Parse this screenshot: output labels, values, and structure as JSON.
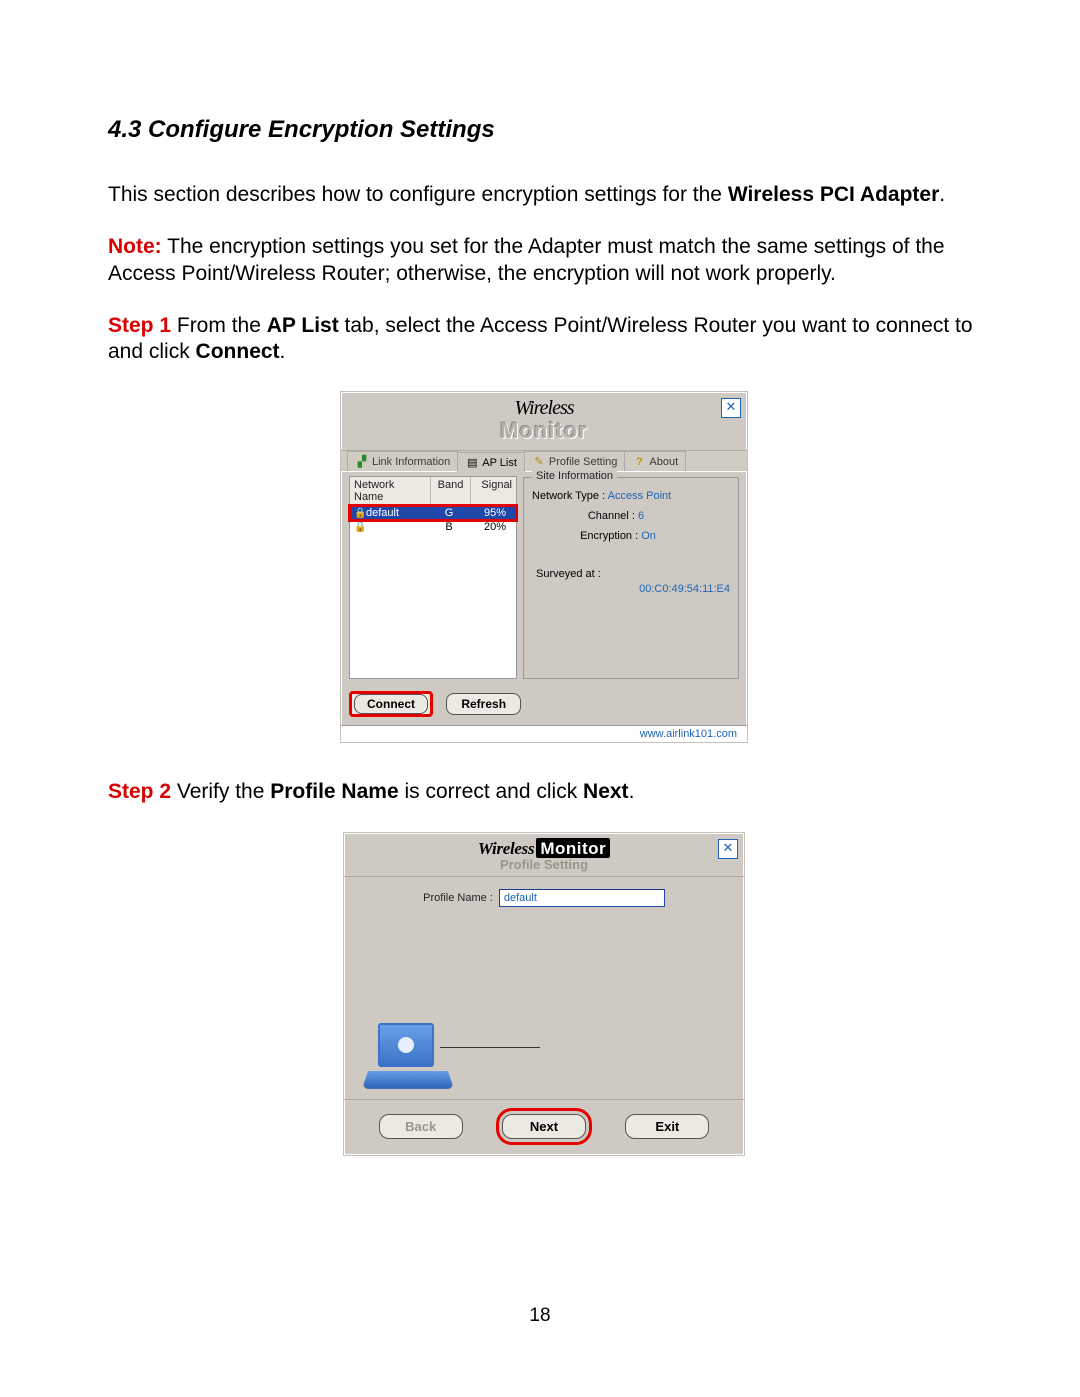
{
  "section": {
    "heading": "4.3 Configure Encryption Settings"
  },
  "para1": {
    "pre": "This section describes how to configure encryption settings for the ",
    "bold": "Wireless PCI Adapter",
    "post": "."
  },
  "para2": {
    "note": "Note:",
    "text": " The encryption settings you set for the Adapter must match the same settings of the Access Point/Wireless Router; otherwise, the encryption will not work properly."
  },
  "para3": {
    "step": "Step 1",
    "t1": " From the ",
    "b1": "AP List",
    "t2": " tab, select the Access Point/Wireless Router you want to connect to and click ",
    "b2": "Connect",
    "t3": "."
  },
  "para4": {
    "step": "Step 2",
    "t1": " Verify the ",
    "b1": "Profile Name",
    "t2": " is correct and click ",
    "b2": "Next",
    "t3": "."
  },
  "fig1": {
    "title_top": "Wireless",
    "title_bottom": "Monitor",
    "close": "✕",
    "tabs": {
      "link": "Link Information",
      "ap": "AP List",
      "profile": "Profile Setting",
      "about": "About"
    },
    "cols": {
      "name": "Network Name",
      "band": "Band",
      "signal": "Signal"
    },
    "rows": [
      {
        "name": "default",
        "band": "G",
        "signal": "95%",
        "selected": true
      },
      {
        "name": "",
        "band": "B",
        "signal": "20%",
        "selected": false
      }
    ],
    "site_legend": "Site Information",
    "site": {
      "type_l": "Network Type :",
      "type_v": "Access Point",
      "chan_l": "Channel :",
      "chan_v": "6",
      "enc_l": "Encryption :",
      "enc_v": "On",
      "surv_l": "Surveyed at :",
      "surv_v": "00:C0:49:54:11:E4"
    },
    "btn_connect": "Connect",
    "btn_refresh": "Refresh",
    "footer": "www.airlink101.com"
  },
  "fig2": {
    "title_wl": "Wireless",
    "title_mon": "Monitor",
    "close": "✕",
    "subtitle": "Profile Setting",
    "profile_label": "Profile Name :",
    "profile_value": "default",
    "btn_back": "Back",
    "btn_next": "Next",
    "btn_exit": "Exit"
  },
  "page_number": "18"
}
